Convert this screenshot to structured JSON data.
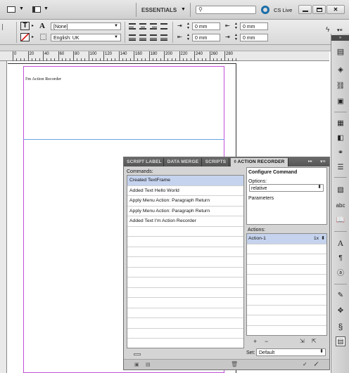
{
  "appbar": {
    "workspace": "ESSENTIALS",
    "search_placeholder": "",
    "cs_live": "CS Live"
  },
  "control": {
    "char_style": "[None]",
    "language": "English: UK",
    "indent_1": "0 mm",
    "indent_2": "0 mm",
    "indent_3": "0 mm",
    "indent_4": "0 mm"
  },
  "ruler": {
    "ticks": [
      "0",
      "20",
      "40",
      "60",
      "80",
      "100",
      "120",
      "140",
      "160",
      "180",
      "200",
      "220",
      "240",
      "260",
      "280"
    ]
  },
  "document": {
    "frame_text": "I'm Action Recorder"
  },
  "panel": {
    "tabs": [
      "SCRIPT LABEL",
      "DATA MERGE",
      "SCRIPTS",
      "◊ ACTION RECORDER"
    ],
    "commands_label": "Commands:",
    "commands": [
      "Created TextFrame",
      "Added Text Hello World",
      "Apply Menu Action: Paragraph Return",
      "Apply Menu Action: Paragraph Return",
      "Added Text I'm Action Recorder"
    ],
    "configure_title": "Configure Command",
    "options_label": "Options:",
    "options_value": "relative",
    "parameters_label": "Parameters",
    "actions_label": "Actions:",
    "actions": [
      {
        "name": "Action-1",
        "count": "1x"
      }
    ],
    "set_label": "Set:",
    "set_value": "Default"
  },
  "icons": {
    "right_toolbar": [
      "pages-icon",
      "layers-icon",
      "links-icon",
      "stroke-icon",
      "swatches-icon",
      "color-icon",
      "effects-icon",
      "gradient-icon",
      "text-wrap-icon",
      "hyperlinks-icon",
      "paragraph-styles-icon",
      "character-styles-icon",
      "spelling-icon",
      "book-icon",
      "type-icon",
      "scripts-icon",
      "data-merge-icon",
      "action-recorder-icon"
    ]
  }
}
